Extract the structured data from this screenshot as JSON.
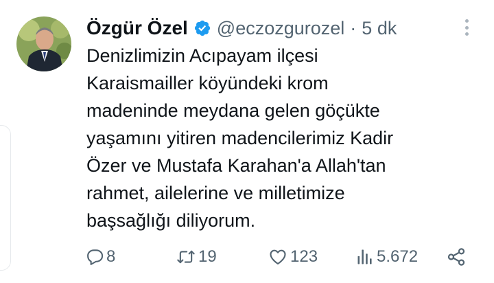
{
  "tweet": {
    "author_name": "Özgür Özel",
    "verified": true,
    "handle": "@eczozgurozel",
    "separator": "·",
    "time": "5 dk",
    "text_lines": [
      "Denizlimizin Acıpayam ilçesi",
      "Karaismailler köyündeki krom",
      "madeninde meydana gelen göçükte",
      "yaşamını yitiren madencilerimiz Kadir",
      "Özer ve Mustafa Karahan'a Allah'tan",
      "rahmet, ailelerine ve milletimize",
      "başsağlığı diliyorum."
    ]
  },
  "actions": {
    "reply_count": "8",
    "retweet_count": "19",
    "like_count": "123",
    "views_count": "5.672"
  },
  "icons": {
    "avatar": "avatar-photo",
    "verified": "verified-badge-icon",
    "more": "more-options-icon",
    "reply": "reply-icon",
    "retweet": "retweet-icon",
    "like": "heart-icon",
    "views": "views-icon",
    "share": "share-icon"
  },
  "colors": {
    "text": "#0f1419",
    "secondary": "#536471",
    "verified_blue": "#1d9bf0"
  }
}
